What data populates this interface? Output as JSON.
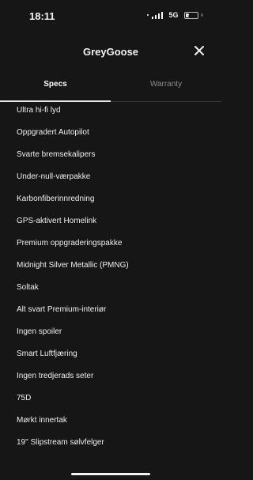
{
  "status": {
    "time": "18:11",
    "network": "5G",
    "battery": "31"
  },
  "header": {
    "title": "GreyGoose",
    "close_icon": "close-icon"
  },
  "tabs": [
    {
      "label": "Specs",
      "active": true
    },
    {
      "label": "Warranty",
      "active": false
    }
  ],
  "specs": [
    "Ultra hi-fi lyd",
    "Oppgradert Autopilot",
    "Svarte bremsekalipers",
    "Under-null-værpakke",
    "Karbonfiberinnredning",
    "GPS-aktivert Homelink",
    "Premium oppgraderingspakke",
    "Midnight Silver Metallic (PMNG)",
    "Soltak",
    "Alt svart Premium-interiør",
    "Ingen spoiler",
    "Smart Luftfjæring",
    "Ingen tredjerads seter",
    "75D",
    "Mørkt innertak",
    "19\" Slipstream sølvfelger"
  ],
  "colors": {
    "background": "#161616",
    "text": "#f2f2f2",
    "muted": "#8a8a8a"
  }
}
